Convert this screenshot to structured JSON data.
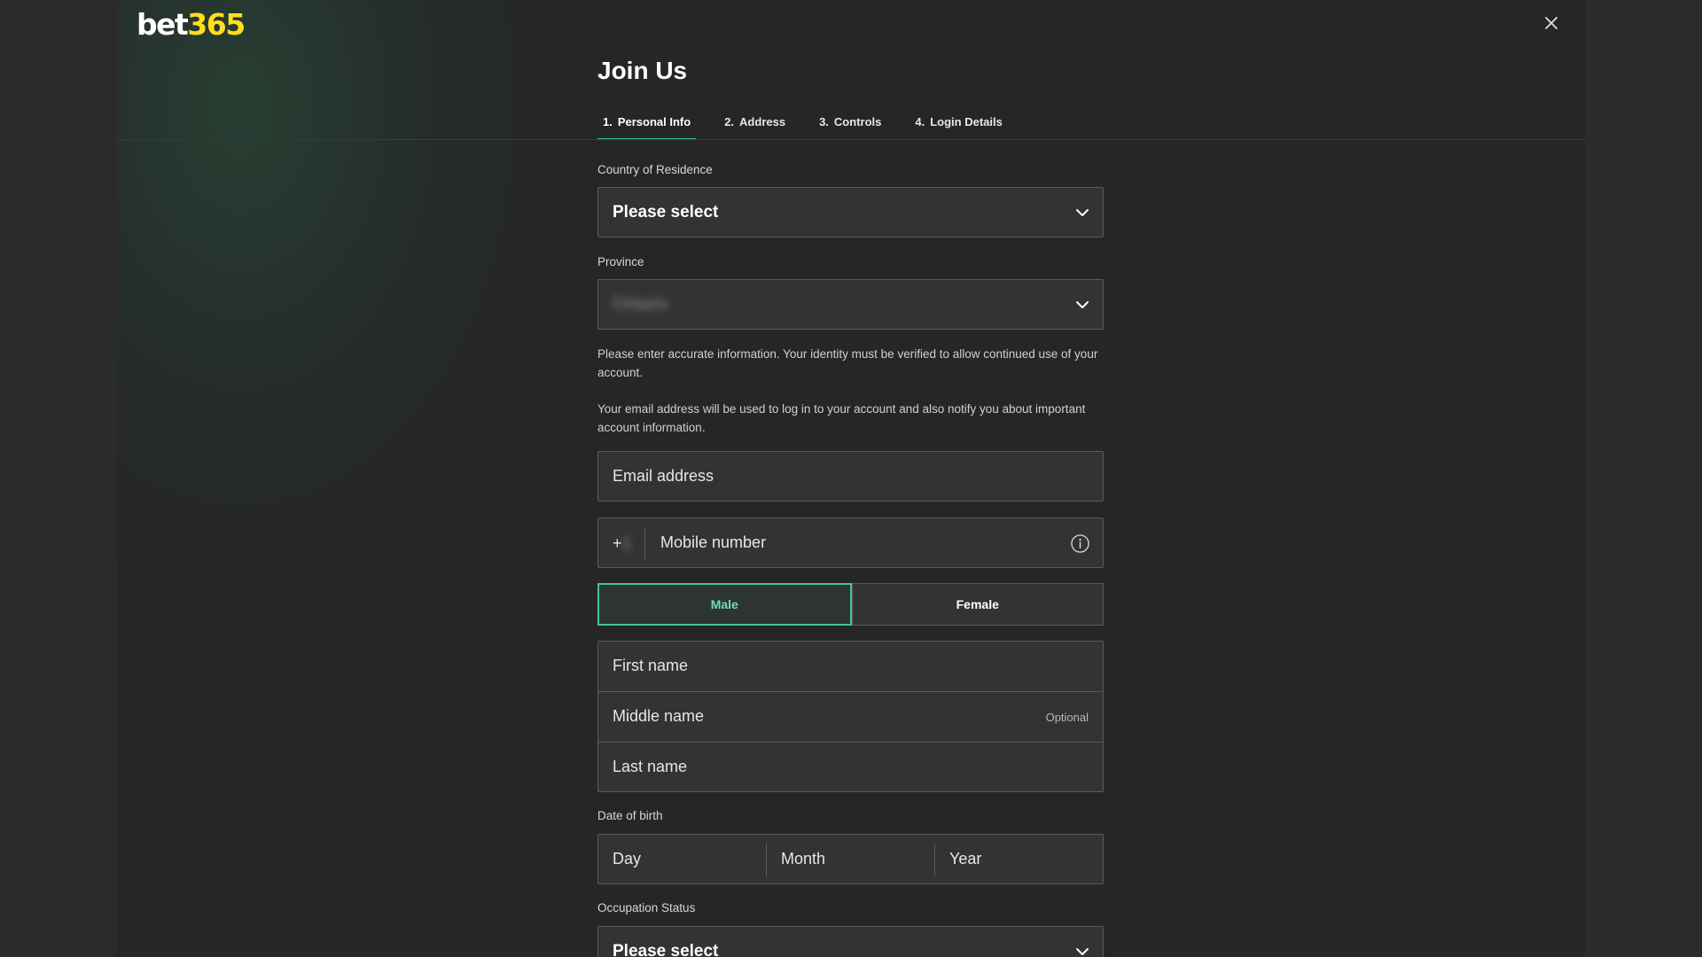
{
  "brand": {
    "logo_part1": "bet",
    "logo_part2": "365"
  },
  "header": {
    "title": "Join Us",
    "close_icon": "close-icon"
  },
  "tabs": [
    {
      "num": "1.",
      "label": "Personal Info",
      "active": true
    },
    {
      "num": "2.",
      "label": "Address",
      "active": false
    },
    {
      "num": "3.",
      "label": "Controls",
      "active": false
    },
    {
      "num": "4.",
      "label": "Login Details",
      "active": false
    }
  ],
  "form": {
    "country": {
      "label": "Country of Residence",
      "value": "Please select"
    },
    "province": {
      "label": "Province",
      "value": "Ontario"
    },
    "info1": "Please enter accurate information. Your identity must be verified to allow continued use of your account.",
    "info2": "Your email address will be used to log in to your account and also notify you about important account information.",
    "email": {
      "placeholder": "Email address"
    },
    "mobile": {
      "prefix": "+",
      "prefix_hidden": "1",
      "placeholder": "Mobile number",
      "info_icon": "info-icon"
    },
    "gender": {
      "male": "Male",
      "female": "Female",
      "selected": "Male"
    },
    "names": {
      "first": "First name",
      "middle": "Middle name",
      "middle_optional": "Optional",
      "last": "Last name"
    },
    "dob": {
      "label": "Date of birth",
      "day": "Day",
      "month": "Month",
      "year": "Year"
    },
    "occupation": {
      "label": "Occupation Status",
      "value": "Please select"
    }
  },
  "colors": {
    "accent_green": "#2ec28a",
    "logo_yellow": "#ffdf1b",
    "background": "#262626"
  }
}
